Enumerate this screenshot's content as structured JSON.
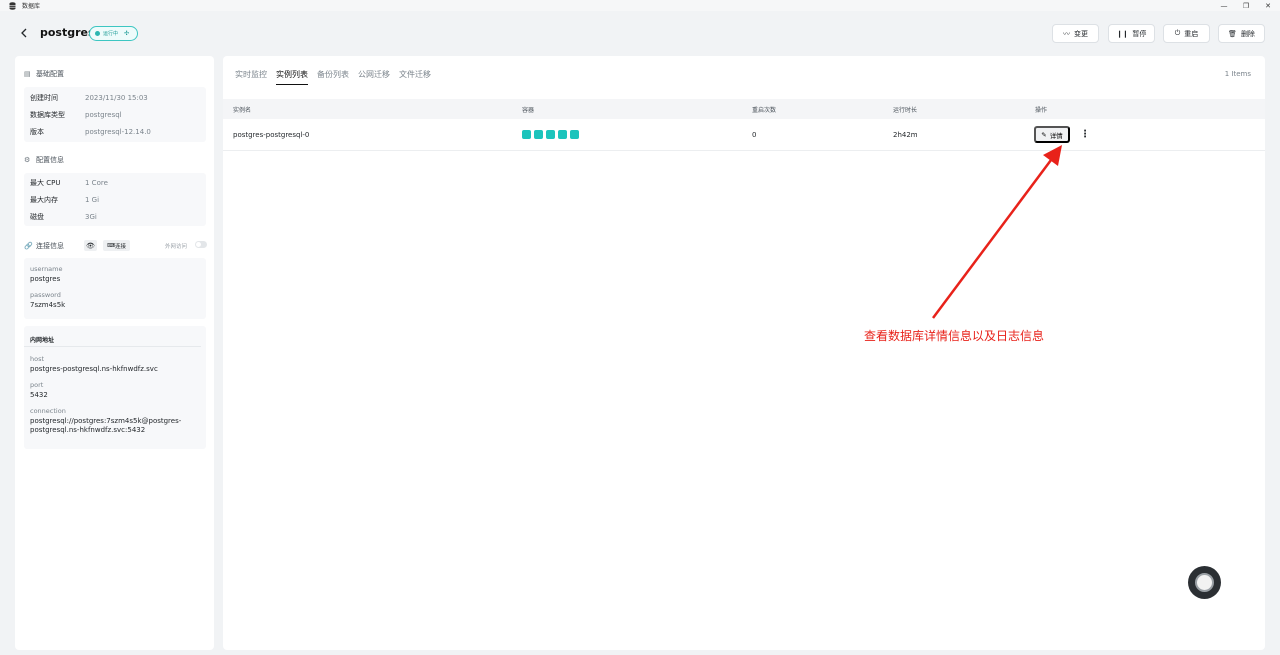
{
  "window": {
    "title": "数据库",
    "min_icon": "minimize-icon",
    "restore_icon": "restore-icon",
    "close_icon": "close-icon"
  },
  "header": {
    "db_name": "postgres",
    "status": "运行中",
    "actions": [
      {
        "label": "变更",
        "icon": "trend-icon"
      },
      {
        "label": "暂停",
        "icon": "pause-icon"
      },
      {
        "label": "重启",
        "icon": "restart-icon"
      },
      {
        "label": "删除",
        "icon": "trash-icon"
      }
    ]
  },
  "basic": {
    "title": "基础配置",
    "rows": [
      {
        "k": "创建时间",
        "v": "2023/11/30 15:03"
      },
      {
        "k": "数据库类型",
        "v": "postgresql"
      },
      {
        "k": "版本",
        "v": "postgresql-12.14.0"
      }
    ]
  },
  "config": {
    "title": "配置信息",
    "rows": [
      {
        "k": "最大 CPU",
        "v": "1 Core"
      },
      {
        "k": "最大内存",
        "v": "1 Gi"
      },
      {
        "k": "磁盘",
        "v": "3Gi"
      }
    ]
  },
  "conn": {
    "title": "连接信息",
    "connect_label": "连接",
    "public_label": "外网访问",
    "username_label": "username",
    "username": "postgres",
    "password_label": "password",
    "password": "7szm4s5k"
  },
  "network": {
    "title": "内网地址",
    "host_label": "host",
    "host": "postgres-postgresql.ns-hkfnwdfz.svc",
    "port_label": "port",
    "port": "5432",
    "connection_label": "connection",
    "connection_line1": "postgresql://postgres:7szm4s5k@postgres-",
    "connection_line2": "postgresql.ns-hkfnwdfz.svc:5432"
  },
  "tabs": [
    "实时监控",
    "实例列表",
    "备份列表",
    "公网迁移",
    "文件迁移"
  ],
  "items_count": "1 Items",
  "table": {
    "headers": [
      "实例名",
      "容器",
      "重启次数",
      "运行时长",
      "操作"
    ],
    "rows": [
      {
        "name": "postgres-postgresql-0",
        "containers": 5,
        "restarts": "0",
        "uptime": "2h42m",
        "detail_label": "详情"
      }
    ]
  },
  "annotation": "查看数据库详情信息以及日志信息",
  "colors": {
    "accent": "#1cc4bc",
    "annotation": "#e8221a"
  }
}
